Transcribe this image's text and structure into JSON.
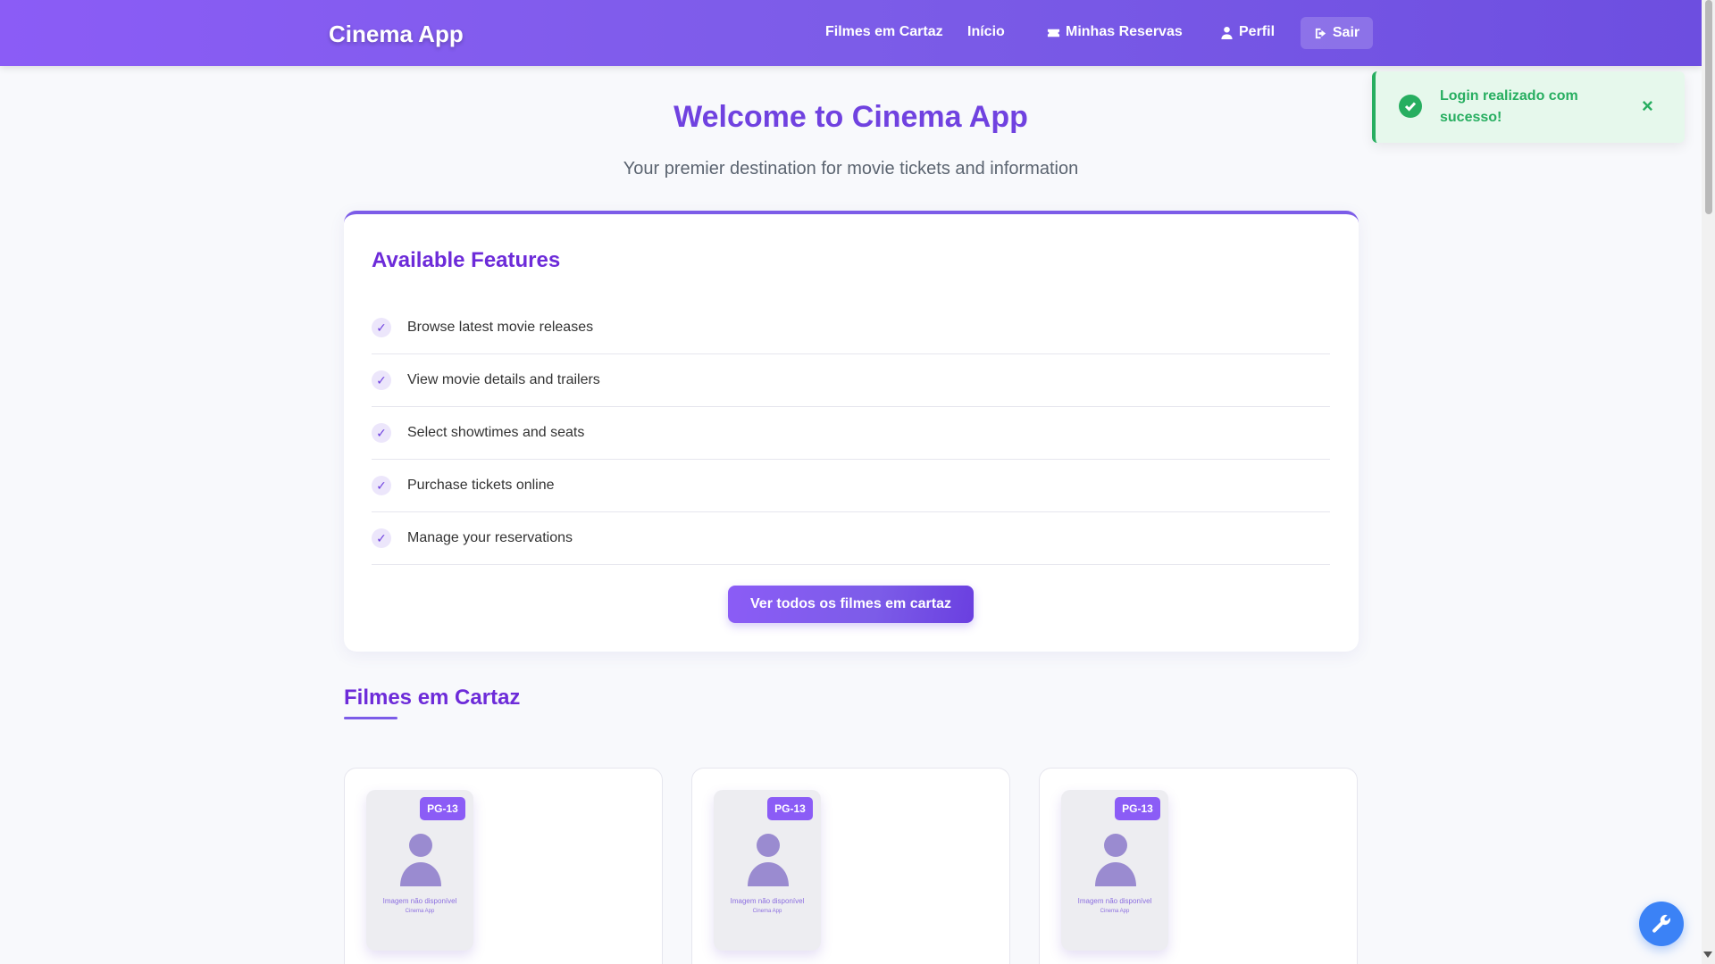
{
  "navbar": {
    "brand": "Cinema App",
    "items": [
      {
        "label": "Filmes em Cartaz"
      },
      {
        "label": "Início"
      },
      {
        "label": "Minhas Reservas",
        "icon": "ticket-icon"
      },
      {
        "label": "Perfil",
        "icon": "user-icon"
      }
    ],
    "logout": {
      "label": "Sair",
      "icon": "sign-out-icon"
    }
  },
  "hero": {
    "title": "Welcome to Cinema App",
    "subtitle": "Your premier destination for movie tickets and information"
  },
  "features": {
    "title": "Available Features",
    "items": [
      {
        "label": "Browse latest movie releases"
      },
      {
        "label": "View movie details and trailers"
      },
      {
        "label": "Select showtimes and seats"
      },
      {
        "label": "Purchase tickets online"
      },
      {
        "label": "Manage your reservations"
      }
    ],
    "check_glyph": "✓",
    "cta_label": "Ver todos os filmes em cartaz"
  },
  "movies_section": {
    "title": "Filmes em Cartaz",
    "cards": [
      {
        "rating": "PG-13",
        "image_placeholder": "Imagem não disponível",
        "image_sub": "Cinema App"
      },
      {
        "rating": "PG-13",
        "image_placeholder": "Imagem não disponível",
        "image_sub": "Cinema App"
      },
      {
        "rating": "PG-13",
        "image_placeholder": "Imagem não disponível",
        "image_sub": "Cinema App"
      }
    ]
  },
  "toast": {
    "message": "Login realizado com sucesso!",
    "close_glyph": "×",
    "icon": "check-circle-icon"
  },
  "fab": {
    "icon": "wrench-icon"
  },
  "colors": {
    "accent": "#7c5ce8",
    "heading": "#6d2bd9",
    "success": "#27ae60",
    "fab": "#3b82f6"
  }
}
